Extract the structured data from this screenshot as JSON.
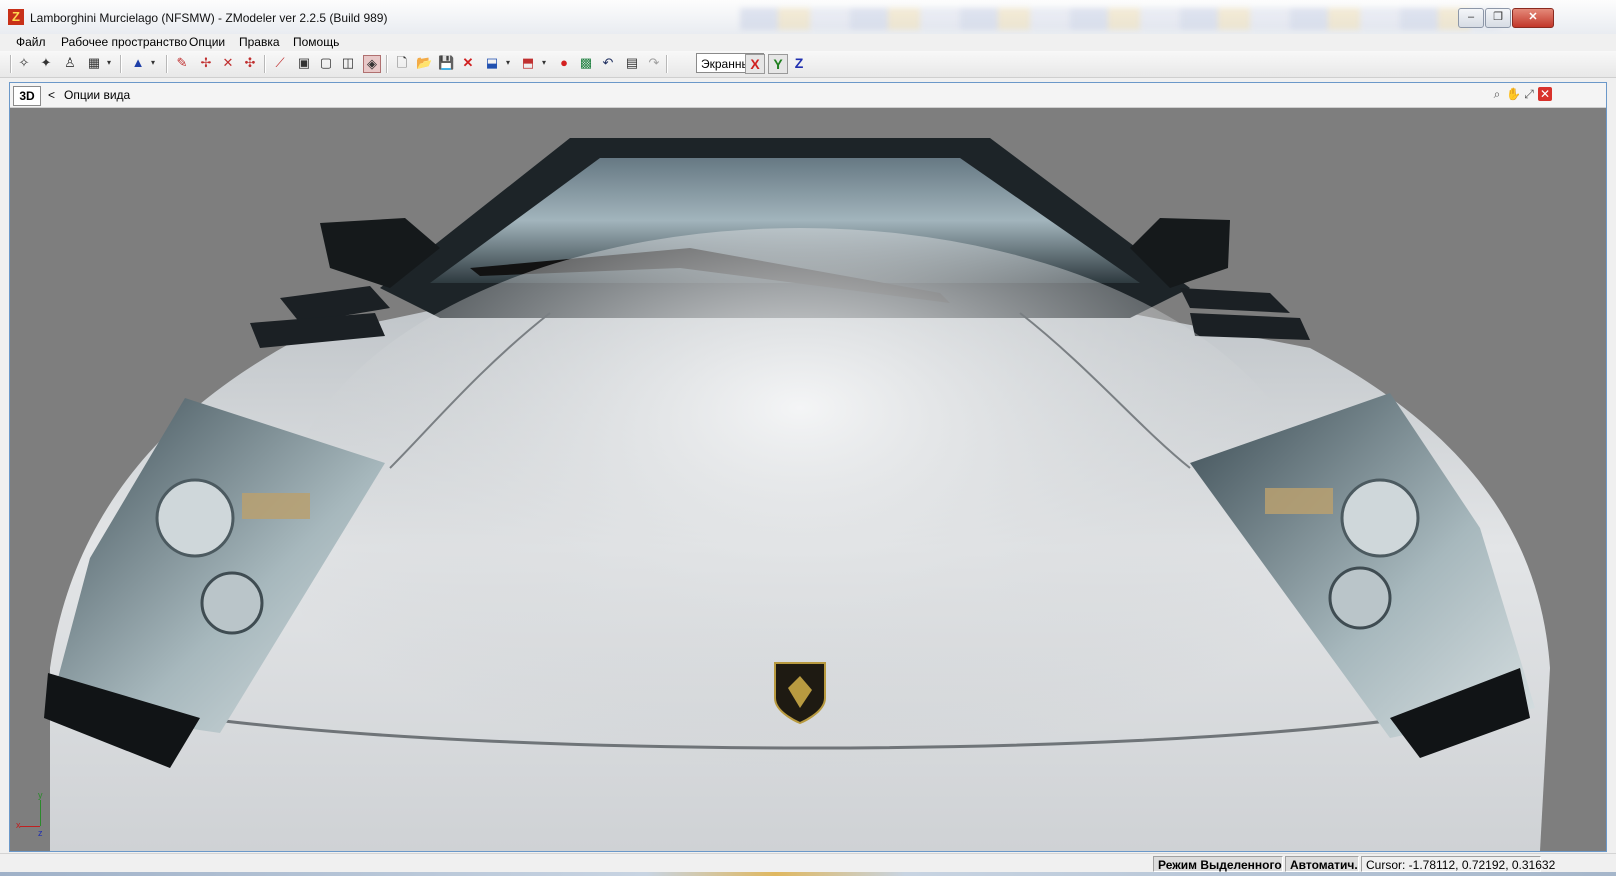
{
  "window": {
    "title": "Lamborghini Murcielago  (NFSMW) - ZModeler ver 2.2.5 (Build 989)",
    "logo_letter": "Z",
    "minimize_label": "–",
    "restore_label": "❐",
    "close_label": "✕"
  },
  "menu": {
    "items": [
      "Файл",
      "Рабочее пространство",
      "Опции",
      "Правка",
      "Помощь"
    ]
  },
  "toolbar": {
    "view_mode": "Экранны",
    "axes": [
      "X",
      "Y",
      "Z"
    ],
    "colors": {
      "axis_x": "#d02020",
      "axis_y": "#208020",
      "axis_z": "#2030b0"
    }
  },
  "viewport": {
    "mode_label": "3D",
    "back_label": "<",
    "options_label": "Опции вида",
    "tools": [
      "magnify-icon",
      "pan-icon",
      "maximize-icon",
      "close-view-icon"
    ],
    "axis_indicator": {
      "x": "x",
      "y": "y",
      "z": "z"
    },
    "colors": {
      "background": "#7d7d7d",
      "body": "#d8dbde",
      "glass": "#3a4a52"
    }
  },
  "statusbar": {
    "mode": "Режим Выделенного",
    "auto": "Автоматич.",
    "cursor": "Cursor: -1.78112, 0.72192, 0.31632"
  }
}
